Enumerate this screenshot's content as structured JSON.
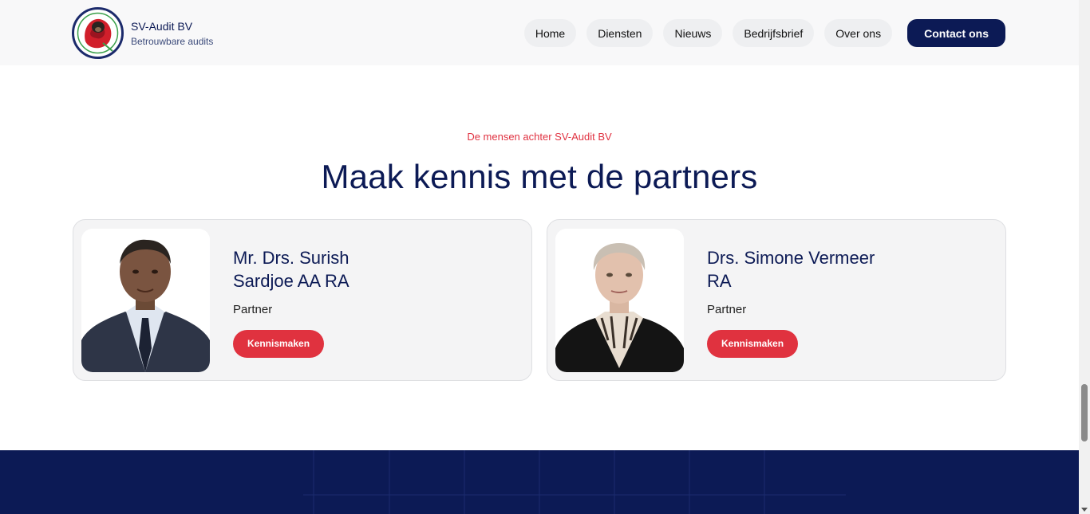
{
  "header": {
    "brand_name": "SV-Audit BV",
    "brand_tagline": "Betrouwbare audits",
    "nav": [
      {
        "label": "Home"
      },
      {
        "label": "Diensten"
      },
      {
        "label": "Nieuws"
      },
      {
        "label": "Bedrijfsbrief"
      },
      {
        "label": "Over ons"
      }
    ],
    "cta_label": "Contact ons"
  },
  "section": {
    "eyebrow": "De mensen achter SV-Audit BV",
    "title": "Maak kennis met de partners"
  },
  "partners": [
    {
      "name": "Mr. Drs. Surish Sardjoe AA RA",
      "role": "Partner",
      "button": "Kennismaken"
    },
    {
      "name": "Drs. Simone Vermeer RA",
      "role": "Partner",
      "button": "Kennismaken"
    }
  ],
  "colors": {
    "navy": "#0c1a55",
    "accent_red": "#e0323f",
    "card_bg": "#f4f4f5"
  },
  "icons": {
    "logo": "rose-emblem-logo",
    "scroll_down": "scroll-down-arrow-icon"
  }
}
